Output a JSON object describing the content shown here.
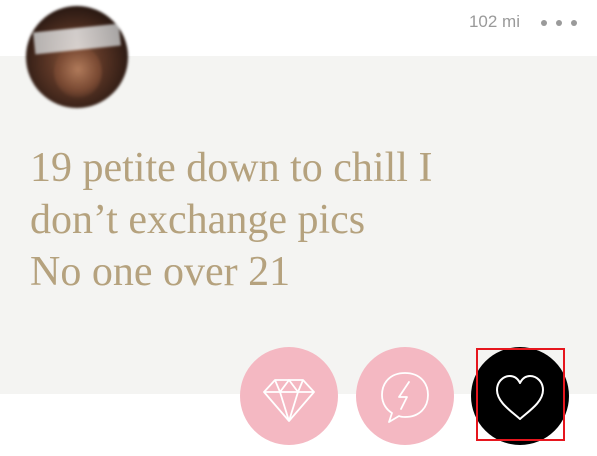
{
  "profile": {
    "distance": "102 mi",
    "prompt_lines": [
      "19 petite down to chill I",
      "don’t exchange pics",
      "No one over 21"
    ]
  },
  "actions": [
    {
      "name": "rose",
      "icon": "diamond-icon",
      "color": "#f4b8c2"
    },
    {
      "name": "superlike",
      "icon": "lightning-bubble-icon",
      "color": "#f4b8c2"
    },
    {
      "name": "like",
      "icon": "heart-icon",
      "color": "#000000"
    }
  ],
  "colors": {
    "prompt_text": "#b5a27e",
    "card_background": "#f4f4f2",
    "highlight": "#e6161e"
  }
}
